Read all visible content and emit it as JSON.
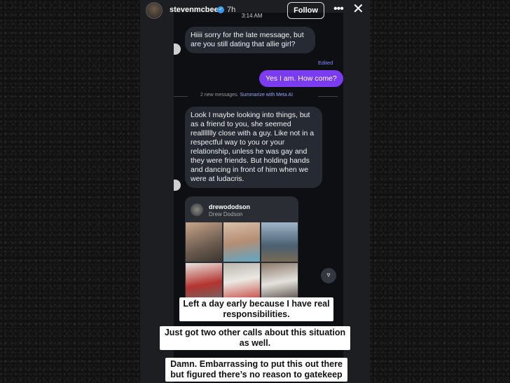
{
  "story": {
    "username": "stevenmcbee",
    "post_age": "7h",
    "follow_label": "Follow",
    "more_icon": "more-horizontal-icon",
    "close_icon": "close-icon"
  },
  "screenshot": {
    "status_time": "3:14 AM",
    "messages": [
      {
        "direction": "incoming",
        "text": "Hiiii sorry for the late message, but are you still dating that allie girl?"
      },
      {
        "direction": "outgoing",
        "text": "Yes I am. How come?",
        "status": "Edited"
      },
      {
        "direction": "incoming",
        "text": "Look I maybe looking into things, but as a friend to you, she seemed reallllllly close with a guy. Like not in a respectful way to you or your relationship, unless he was gay and they were friends. But holding hands and dancing in front of him when we were at ludacris."
      }
    ],
    "new_messages_label": "2 new messages.",
    "summarize_label": "Summarize with Meta AI",
    "shared_post": {
      "username": "drewododson",
      "display_name": "Drew Dodson"
    }
  },
  "captions": [
    "Left a day early because I have real responsibilities.",
    "Just got two other calls about this situation as well.",
    "Damn. Embarrassing to put this out there but figured there’s no reason to gatekeep"
  ],
  "colors": {
    "outgoing_bubble": "#7b3bf1",
    "incoming_bubble": "#262a33",
    "verified": "#3897f0",
    "link": "#9aa6ff"
  }
}
